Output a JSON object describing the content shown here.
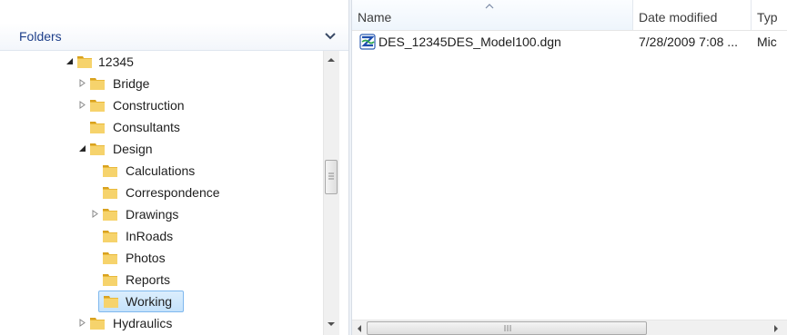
{
  "folders_pane": {
    "title": "Folders",
    "tree": [
      {
        "label": "12345",
        "expander": "expanded",
        "selected": false
      },
      {
        "label": "Bridge",
        "expander": "collapsed",
        "selected": false
      },
      {
        "label": "Construction",
        "expander": "collapsed",
        "selected": false
      },
      {
        "label": "Consultants",
        "expander": "none",
        "selected": false
      },
      {
        "label": "Design",
        "expander": "expanded",
        "selected": false
      },
      {
        "label": "Calculations",
        "expander": "none",
        "selected": false
      },
      {
        "label": "Correspondence",
        "expander": "none",
        "selected": false
      },
      {
        "label": "Drawings",
        "expander": "collapsed",
        "selected": false
      },
      {
        "label": "InRoads",
        "expander": "none",
        "selected": false
      },
      {
        "label": "Photos",
        "expander": "none",
        "selected": false
      },
      {
        "label": "Reports",
        "expander": "none",
        "selected": false
      },
      {
        "label": "Working",
        "expander": "none",
        "selected": true
      },
      {
        "label": "Hydraulics",
        "expander": "collapsed",
        "selected": false
      }
    ]
  },
  "file_list": {
    "columns": {
      "name": "Name",
      "date_modified": "Date modified",
      "type": "Typ"
    },
    "sort_column": "name",
    "rows": [
      {
        "name": "DES_12345DES_Model100.dgn",
        "date_modified": "7/28/2009 7:08 ...",
        "type": "Mic",
        "icon": "microstation-dgn-file-icon"
      }
    ]
  },
  "colors": {
    "folder_yellow": "#f2c94c",
    "header_blue": "#1e3f8a",
    "selection_border": "#7fb8ee"
  }
}
